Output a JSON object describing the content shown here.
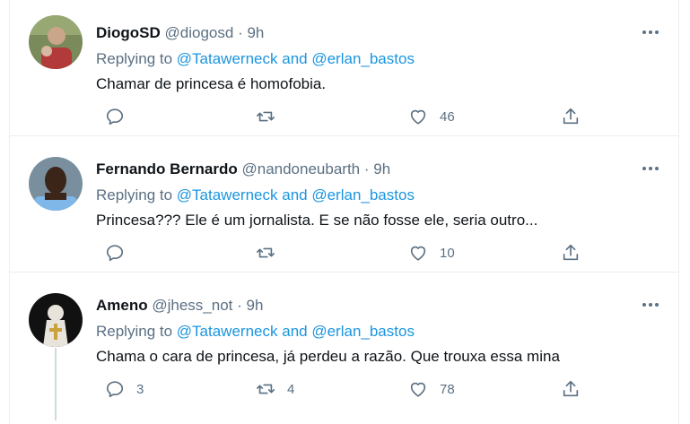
{
  "tweets": [
    {
      "name": "DiogoSD",
      "handle": "@diogosd",
      "time": "· 9h",
      "replying_prefix": "Replying to",
      "mention1": "@Tatawerneck",
      "and_word": "and",
      "mention2": "@erlan_bastos",
      "text": "Chamar de princesa é homofobia.",
      "replies": "",
      "retweets": "",
      "likes": "46",
      "avatar_colors": [
        "#7a8a5a",
        "#c9a58a",
        "#b23a3a"
      ]
    },
    {
      "name": "Fernando Bernardo",
      "handle": "@nandoneubarth",
      "time": "· 9h",
      "replying_prefix": "Replying to",
      "mention1": "@Tatawerneck",
      "and_word": "and",
      "mention2": "@erlan_bastos",
      "text": "Princesa??? Ele é um jornalista. E se não fosse ele, seria outro...",
      "replies": "",
      "retweets": "",
      "likes": "10",
      "avatar_colors": [
        "#7a8f9e",
        "#3b2418",
        "#7fb7e8"
      ]
    },
    {
      "name": "Ameno",
      "handle": "@jhess_not",
      "time": "· 9h",
      "replying_prefix": "Replying to",
      "mention1": "@Tatawerneck",
      "and_word": "and",
      "mention2": "@erlan_bastos",
      "text": "Chama o cara de princesa, já perdeu a razão. Que trouxa essa mina",
      "replies": "3",
      "retweets": "4",
      "likes": "78",
      "avatar_colors": [
        "#111111",
        "#e8e4dc",
        "#c8a23a"
      ]
    }
  ],
  "colors": {
    "text": "#0f1419",
    "secondary": "#5b7083",
    "mention": "#1b95e0",
    "border": "#ebeef0"
  },
  "icons": [
    "reply-icon",
    "retweet-icon",
    "like-icon",
    "share-icon",
    "more-icon"
  ]
}
